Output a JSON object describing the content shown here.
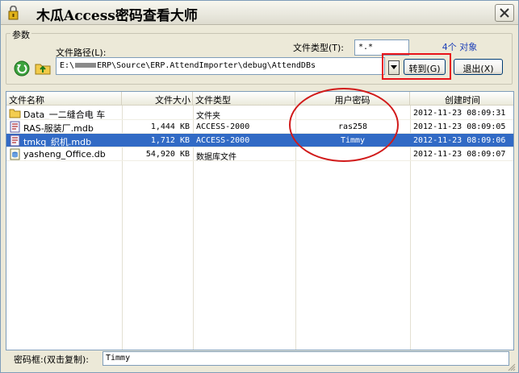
{
  "window": {
    "title": "木瓜Access密码查看大师"
  },
  "params": {
    "group_label": "参数",
    "path_label": "文件路径(L):",
    "path_prefix": "E:\\",
    "path_suffix": "ERP\\Source\\ERP.AttendImporter\\debug\\AttendDBs",
    "type_label": "文件类型(T):",
    "type_value": "*.*",
    "object_count": "4个 对象",
    "goto_label": "转到(G)",
    "exit_label": "退出(X)"
  },
  "list": {
    "columns": [
      "文件名称",
      "文件大小",
      "文件类型",
      "用户密码",
      "创建时间"
    ],
    "rows": [
      {
        "icon": "folder-icon",
        "name": "Data_一二缝合电 车",
        "size": "",
        "type": "文件夹",
        "password": "",
        "created": "2012-11-23 08:09:31",
        "selected": false
      },
      {
        "icon": "mdb-file-icon",
        "name": "RAS-服装厂.mdb",
        "size": "1,444 KB",
        "type": "ACCESS-2000",
        "password": "ras258",
        "created": "2012-11-23 08:09:05",
        "selected": false
      },
      {
        "icon": "mdb-file-icon",
        "name": "tmkq_织机.mdb",
        "size": "1,712 KB",
        "type": "ACCESS-2000",
        "password": "Timmy",
        "created": "2012-11-23 08:09:06",
        "selected": true
      },
      {
        "icon": "db-file-icon",
        "name": "yasheng_Office.db",
        "size": "54,920 KB",
        "type": "数据库文件",
        "password": "",
        "created": "2012-11-23 08:09:07",
        "selected": false
      }
    ]
  },
  "status": {
    "label": "密码框:(双击复制):",
    "value": "Timmy"
  },
  "colors": {
    "selection": "#316ac5",
    "annotation_red": "#e8131a",
    "count_blue": "#1c3fb8"
  }
}
